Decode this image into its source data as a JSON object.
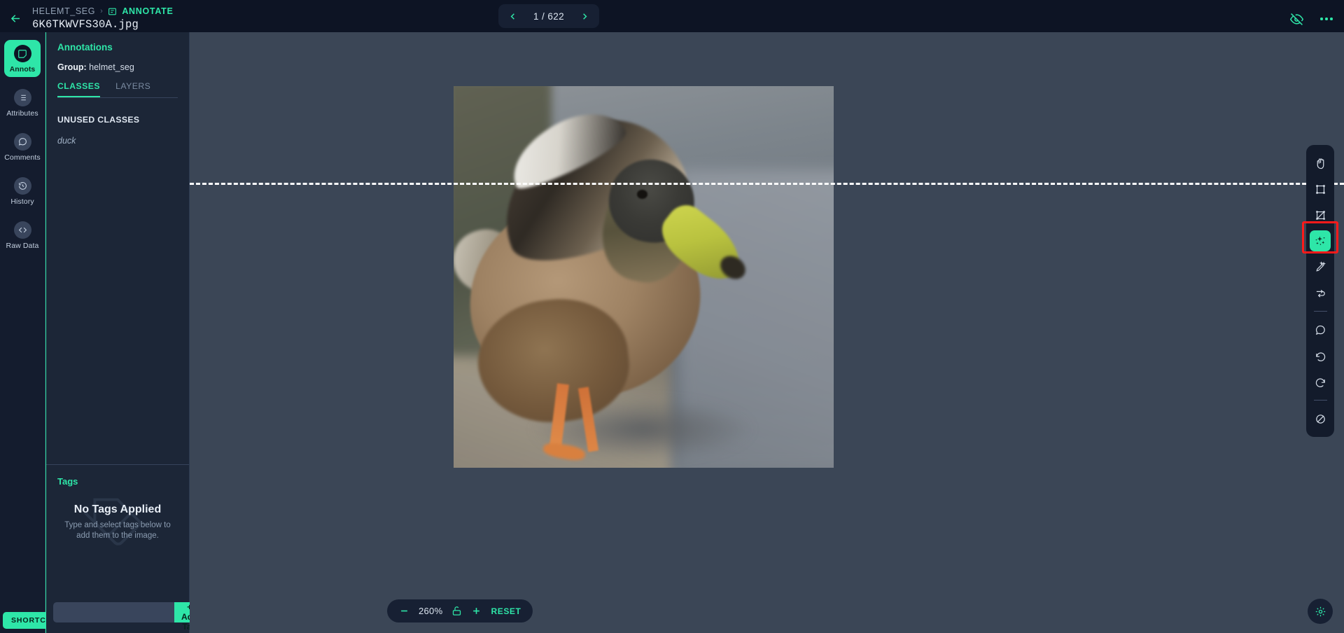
{
  "header": {
    "back_icon": "arrow-left-icon",
    "breadcrumb_project": "HELEMT_SEG",
    "breadcrumb_separator": "›",
    "breadcrumb_section_icon": "annotate-icon",
    "breadcrumb_section": "ANNOTATE",
    "filename": "6K6TKWVFS30A.jpg",
    "nav": {
      "prev_icon": "chevron-left-icon",
      "counter": "1 / 622",
      "next_icon": "chevron-right-icon"
    },
    "hide_icon": "eye-off-icon",
    "more_icon": "more-horizontal-icon"
  },
  "rail": {
    "items": [
      {
        "label": "Annots",
        "icon": "annotation-square-icon",
        "active": true
      },
      {
        "label": "Attributes",
        "icon": "list-icon",
        "active": false
      },
      {
        "label": "Comments",
        "icon": "comment-icon",
        "active": false
      },
      {
        "label": "History",
        "icon": "history-clock-icon",
        "active": false
      },
      {
        "label": "Raw Data",
        "icon": "code-icon",
        "active": false
      }
    ],
    "shortcuts_label": "SHORTCUTS"
  },
  "panel": {
    "title": "Annotations",
    "group_label": "Group:",
    "group_value": "helmet_seg",
    "tabs": [
      {
        "label": "CLASSES",
        "active": true
      },
      {
        "label": "LAYERS",
        "active": false
      }
    ],
    "unused_classes_heading": "UNUSED CLASSES",
    "classes": [
      {
        "name": "duck"
      }
    ],
    "tags": {
      "title": "Tags",
      "empty_heading": "No Tags Applied",
      "empty_body": "Type and select tags below to add them to the image.",
      "input_value": "",
      "input_placeholder": "",
      "add_button": "+ Add Tag"
    }
  },
  "canvas": {
    "image_alt": "duck photo",
    "guide_line": "horizontal-dashed-guide"
  },
  "zoom_controls": {
    "minus_icon": "minus-icon",
    "level": "260%",
    "lock_icon": "unlock-icon",
    "plus_icon": "plus-icon",
    "reset_label": "RESET"
  },
  "toolbar": {
    "highlight_color": "#ff1a1a",
    "accent_color": "#2ee6a8",
    "tools": [
      {
        "name": "pan-hand-icon",
        "selected": false
      },
      {
        "name": "bounding-box-icon",
        "selected": false
      },
      {
        "name": "polygon-icon",
        "selected": false
      },
      {
        "name": "magic-segment-icon",
        "selected": true
      },
      {
        "name": "magic-pen-icon",
        "selected": false
      },
      {
        "name": "interpolate-icon",
        "selected": false
      },
      {
        "name": "separator",
        "selected": false
      },
      {
        "name": "comment-bubble-icon",
        "selected": false
      },
      {
        "name": "undo-icon",
        "selected": false
      },
      {
        "name": "redo-icon",
        "selected": false
      },
      {
        "name": "separator",
        "selected": false
      },
      {
        "name": "no-entry-icon",
        "selected": false
      }
    ],
    "settings_icon": "brightness-settings-icon"
  }
}
